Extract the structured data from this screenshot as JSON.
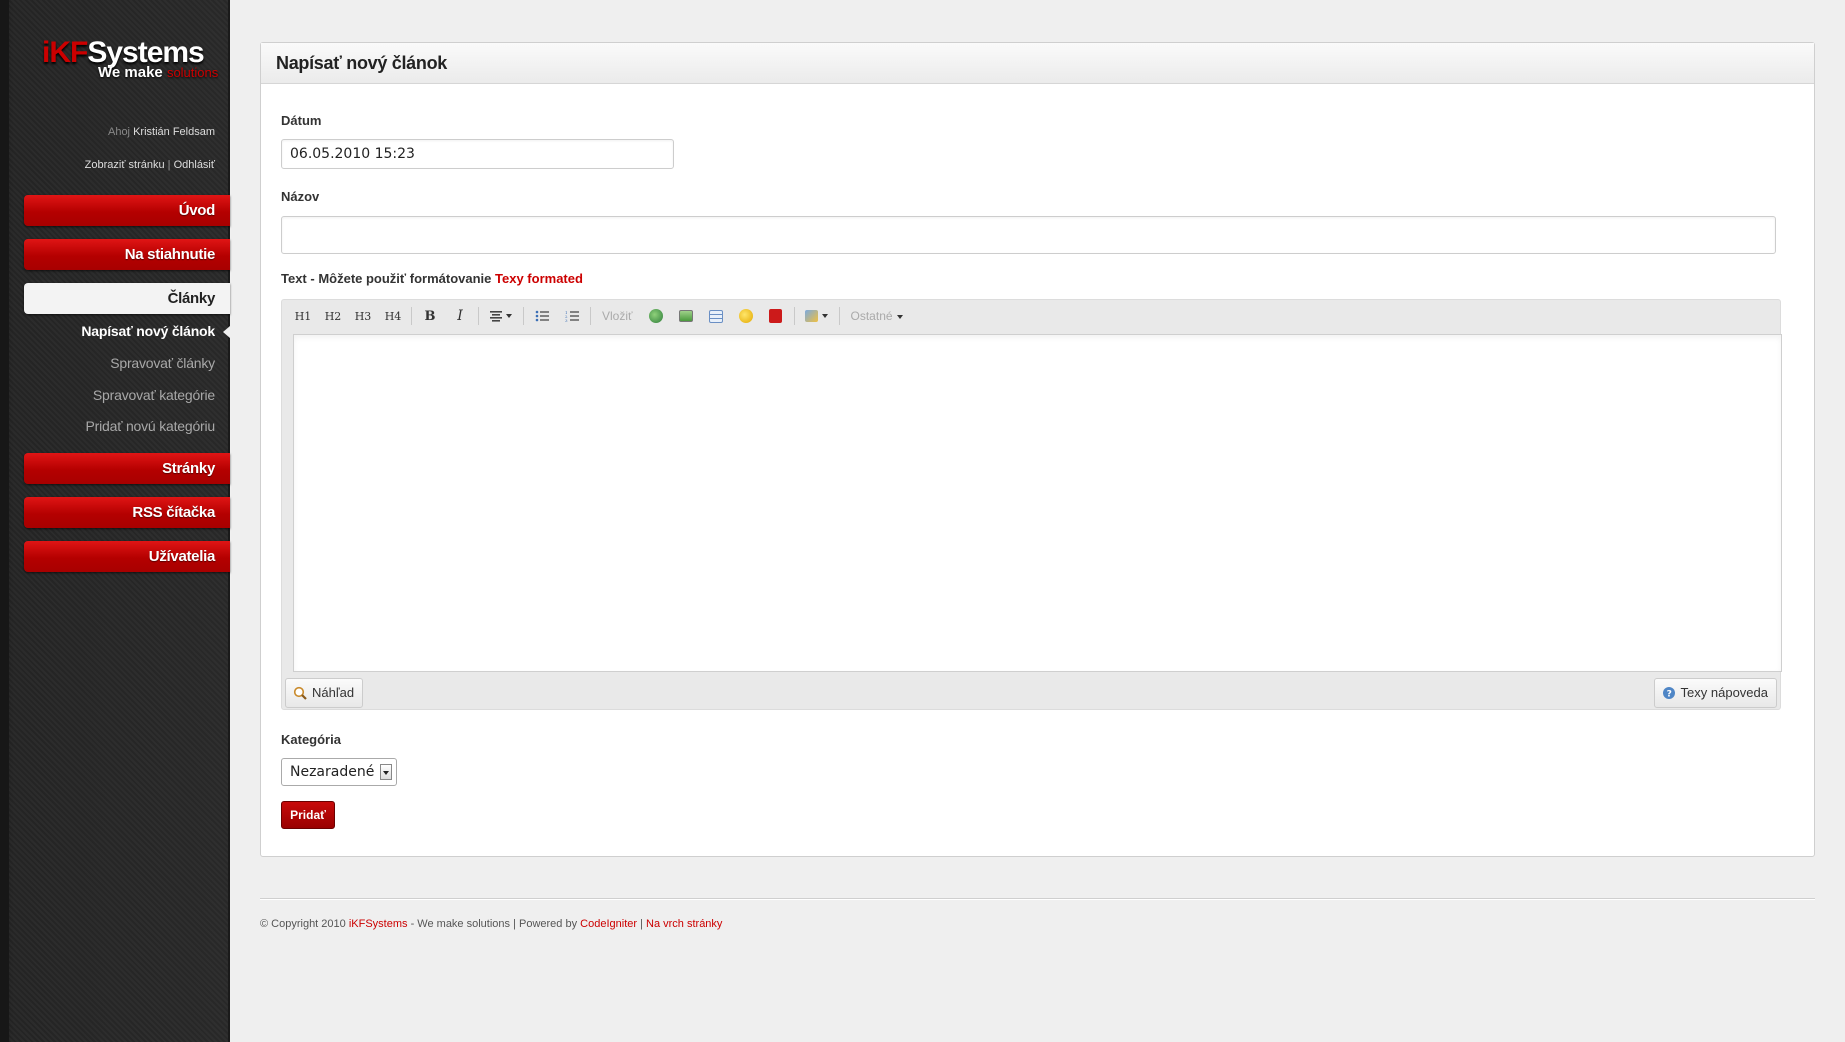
{
  "sidebar": {
    "logo": {
      "brand_red": "iKF",
      "brand_white": "Systems",
      "tagline_white": "We make",
      "tagline_red": "solutions"
    },
    "greeting_prefix": "Ahoj",
    "user_name": "Kristián Feldsam",
    "view_site_link": "Zobraziť stránku",
    "link_separator": "|",
    "logout_link": "Odhlásiť",
    "nav": {
      "home": "Úvod",
      "downloads": "Na stiahnutie",
      "articles": "Články",
      "pages": "Stránky",
      "rss": "RSS čítačka",
      "users": "Užívatelia"
    },
    "articles_sub": {
      "write": "Napísať nový článok",
      "manage": "Spravovať články",
      "manage_categories": "Spravovať kategórie",
      "add_category": "Pridať novú kategóriu"
    }
  },
  "panel": {
    "title": "Napísať nový článok",
    "date_label": "Dátum",
    "date_value": "06.05.2010 15:23",
    "name_label": "Názov",
    "name_value": "",
    "text_label": "Text - Môžete použiť formátovanie",
    "text_label_link": "Texy formated",
    "toolbar": {
      "h1": "H1",
      "h2": "H2",
      "h3": "H3",
      "h4": "H4",
      "bold": "B",
      "italic": "I",
      "insert": "Vložiť",
      "other": "Ostatné"
    },
    "preview_button": "Náhľad",
    "help_button": "Texy nápoveda",
    "category_label": "Kategória",
    "category_selected": "Nezaradené",
    "submit_button": "Pridať"
  },
  "footer": {
    "copyright": "© Copyright 2010",
    "brand": "iKFSystems",
    "tagline": "- We make solutions | Powered by",
    "framework": "CodeIgniter",
    "sep": "|",
    "top_link": "Na vrch stránky"
  },
  "colors": {
    "accent": "#cc0000",
    "sidebar_bg": "#2a2a2a",
    "page_bg": "#efefef"
  }
}
